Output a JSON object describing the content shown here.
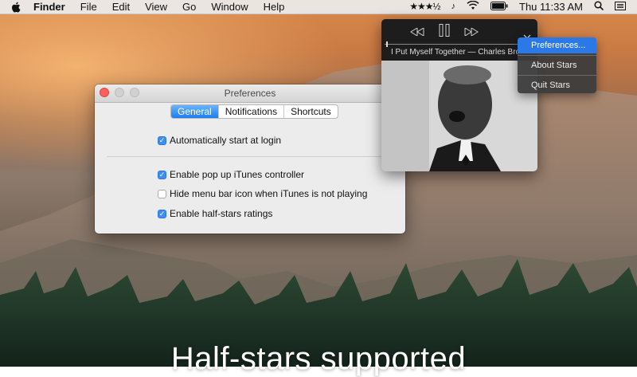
{
  "menubar": {
    "items": [
      "Finder",
      "File",
      "Edit",
      "View",
      "Go",
      "Window",
      "Help"
    ],
    "stars_icon": "★★★½",
    "clock": "Thu 11:33 AM"
  },
  "prefs": {
    "title": "Preferences",
    "tabs": [
      "General",
      "Notifications",
      "Shortcuts"
    ],
    "options": [
      {
        "label": "Automatically start at login",
        "checked": true
      },
      {
        "label": "Enable pop up iTunes controller",
        "checked": true
      },
      {
        "label": "Hide menu bar icon when iTunes is not playing",
        "checked": false
      },
      {
        "label": "Enable half-stars ratings",
        "checked": true
      }
    ]
  },
  "player": {
    "track": "I Put Myself Together — Charles Bro",
    "progress": 0.01
  },
  "menu": {
    "items": [
      "Preferences...",
      "About Stars",
      "Quit Stars"
    ]
  },
  "banner": "Half-stars supported",
  "colors": {
    "accent": "#2a79e6",
    "close": "#fc605c"
  }
}
